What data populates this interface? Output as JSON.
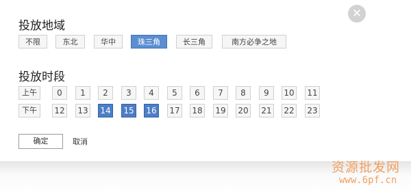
{
  "close_glyph": "✕",
  "region": {
    "title": "投放地域",
    "options": [
      {
        "label": "不限",
        "selected": false
      },
      {
        "label": "东北",
        "selected": false
      },
      {
        "label": "华中",
        "selected": false
      },
      {
        "label": "珠三角",
        "selected": true
      },
      {
        "label": "长三角",
        "selected": false
      },
      {
        "label": "南方必争之地",
        "selected": false
      }
    ]
  },
  "time": {
    "title": "投放时段",
    "am_label": "上午",
    "pm_label": "下午",
    "am_hours": [
      "0",
      "1",
      "2",
      "3",
      "4",
      "5",
      "6",
      "7",
      "8",
      "9",
      "10",
      "11"
    ],
    "pm_hours": [
      "12",
      "13",
      "14",
      "15",
      "16",
      "17",
      "18",
      "19",
      "20",
      "21",
      "22",
      "23"
    ],
    "selected_hours": [
      "14",
      "15",
      "16"
    ]
  },
  "actions": {
    "ok": "确定",
    "cancel": "取消"
  },
  "watermark": {
    "cn": "资源批发网",
    "url": "www.6pf.cn"
  },
  "colors": {
    "selected_region": "#5b8ed1",
    "selected_hour": "#4d7ec6",
    "watermark": "#f1a060"
  }
}
